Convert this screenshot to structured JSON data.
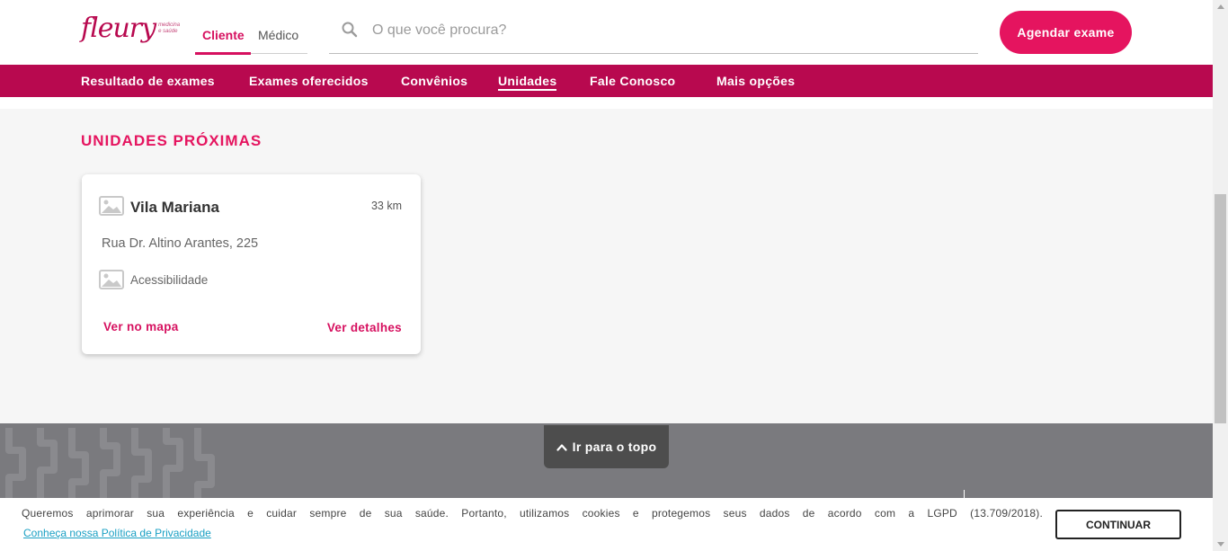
{
  "header": {
    "logo": {
      "text": "fleury",
      "tagline_line1": "medicina",
      "tagline_line2": "e saúde"
    },
    "tabs": [
      {
        "label": "Cliente",
        "active": true
      },
      {
        "label": "Médico",
        "active": false
      }
    ],
    "search": {
      "placeholder": "O que você procura?"
    },
    "cta_label": "Agendar exame"
  },
  "nav": {
    "items": [
      {
        "label": "Resultado de exames"
      },
      {
        "label": "Exames oferecidos"
      },
      {
        "label": "Convênios"
      },
      {
        "label": "Unidades",
        "active": true
      },
      {
        "label": "Fale Conosco"
      },
      {
        "label": "Mais opções"
      }
    ]
  },
  "section": {
    "title": "UNIDADES PRÓXIMAS",
    "card": {
      "name": "Vila Mariana",
      "distance": "33 km",
      "address": "Rua Dr. Altino Arantes, 225",
      "feature": "Acessibilidade",
      "map_link": "Ver no mapa",
      "details_link": "Ver detalhes"
    }
  },
  "footer": {
    "to_top_label": "Ir para o topo"
  },
  "cookie": {
    "text": "Queremos aprimorar sua experiência e cuidar sempre de sua saúde. Portanto, utilizamos cookies e protegemos seus dados de acordo com a LGPD (13.709/2018).",
    "link": "Conheça nossa Política de Privacidade",
    "button": "CONTINUAR"
  },
  "colors": {
    "brand": "#e5145f",
    "nav_bg": "#b8094f",
    "footer_bg": "#7a7a7e"
  }
}
